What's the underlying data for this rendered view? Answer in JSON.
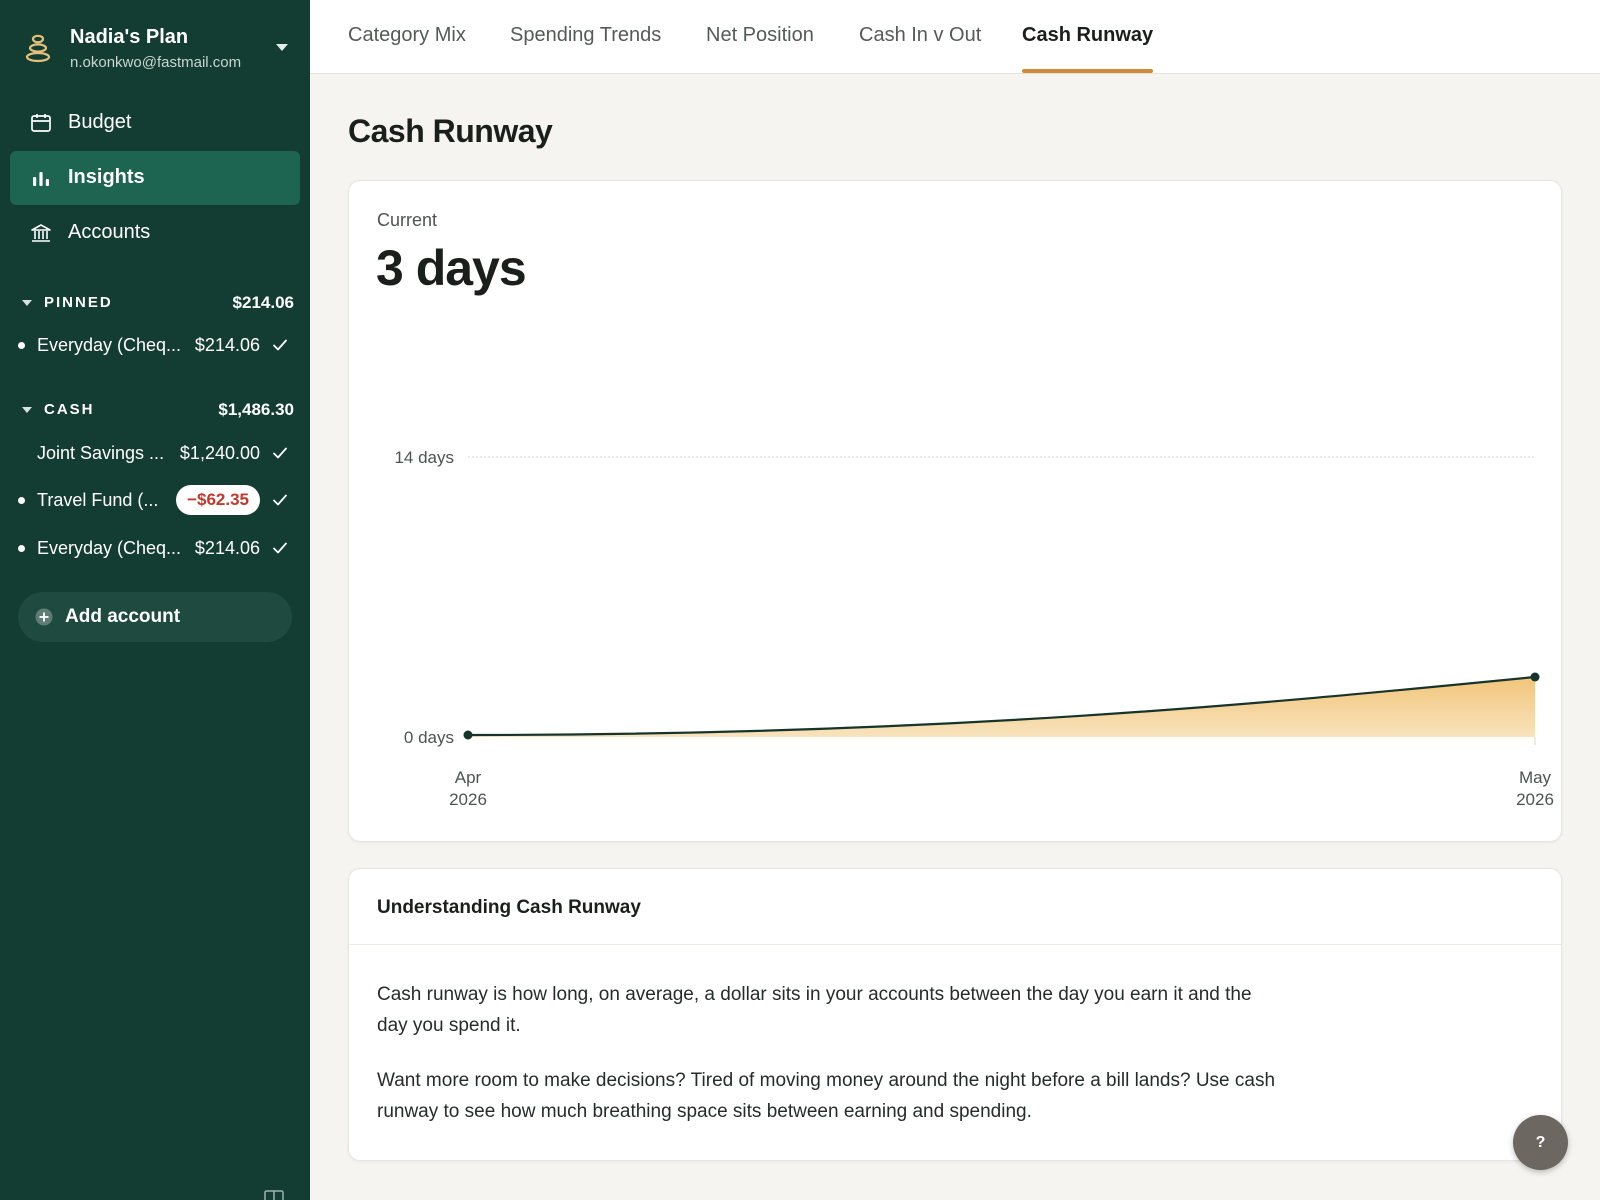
{
  "sidebar": {
    "plan_name": "Nadia's Plan",
    "plan_email": "n.okonkwo@fastmail.com",
    "nav": [
      {
        "label": "Budget",
        "icon": "calendar-icon",
        "active": false
      },
      {
        "label": "Insights",
        "icon": "bar-chart-icon",
        "active": true
      },
      {
        "label": "Accounts",
        "icon": "bank-icon",
        "active": false
      }
    ],
    "groups": {
      "pinned": {
        "name": "PINNED",
        "total": "$214.06",
        "accounts": [
          {
            "name": "Everyday (Cheq...",
            "balance": "$214.06"
          }
        ]
      },
      "cash": {
        "name": "CASH",
        "total": "$1,486.30",
        "accounts": [
          {
            "name": "Joint Savings ...",
            "balance": "$1,240.00"
          },
          {
            "name": "Travel Fund (...",
            "balance": "−$62.35"
          },
          {
            "name": "Everyday (Cheq...",
            "balance": "$214.06"
          }
        ]
      }
    },
    "add_account_label": "Add account"
  },
  "tabs": [
    {
      "label": "Category Mix",
      "active": false
    },
    {
      "label": "Spending Trends",
      "active": false
    },
    {
      "label": "Net Position",
      "active": false
    },
    {
      "label": "Cash In v Out",
      "active": false
    },
    {
      "label": "Cash Runway",
      "active": true
    }
  ],
  "page_title": "Cash Runway",
  "current": {
    "label": "Current",
    "value": "3 days"
  },
  "chart_data": {
    "type": "area",
    "x": [
      "Apr 2026",
      "May 2026"
    ],
    "x_tick_labels": [
      [
        "Apr",
        "2026"
      ],
      [
        "May",
        "2026"
      ]
    ],
    "y_tick_labels": [
      "14 days",
      "0 days"
    ],
    "ylim": [
      0,
      14
    ],
    "series": [
      {
        "values": [
          0.1,
          3.0
        ]
      }
    ],
    "grid": true,
    "colors": {
      "line": "#17342b",
      "fill_top": "#f2c57a",
      "fill_bottom": "#f8e3bd",
      "gridline": "#d6d6d6"
    }
  },
  "info": {
    "title": "Understanding Cash Runway",
    "p1": "Cash runway is how long, on average, a dollar sits in your accounts between the day you earn it and the day you spend it.",
    "p2": "Want more room to make decisions? Tired of moving money around the night before a bill lands? Use cash runway to see how much breathing space sits between earning and spending."
  },
  "help_label": "?",
  "colors": {
    "sidebar_bg": "#133c33",
    "sidebar_active": "#1d6451",
    "accent": "#d1893c",
    "negative": "#c0392b"
  }
}
